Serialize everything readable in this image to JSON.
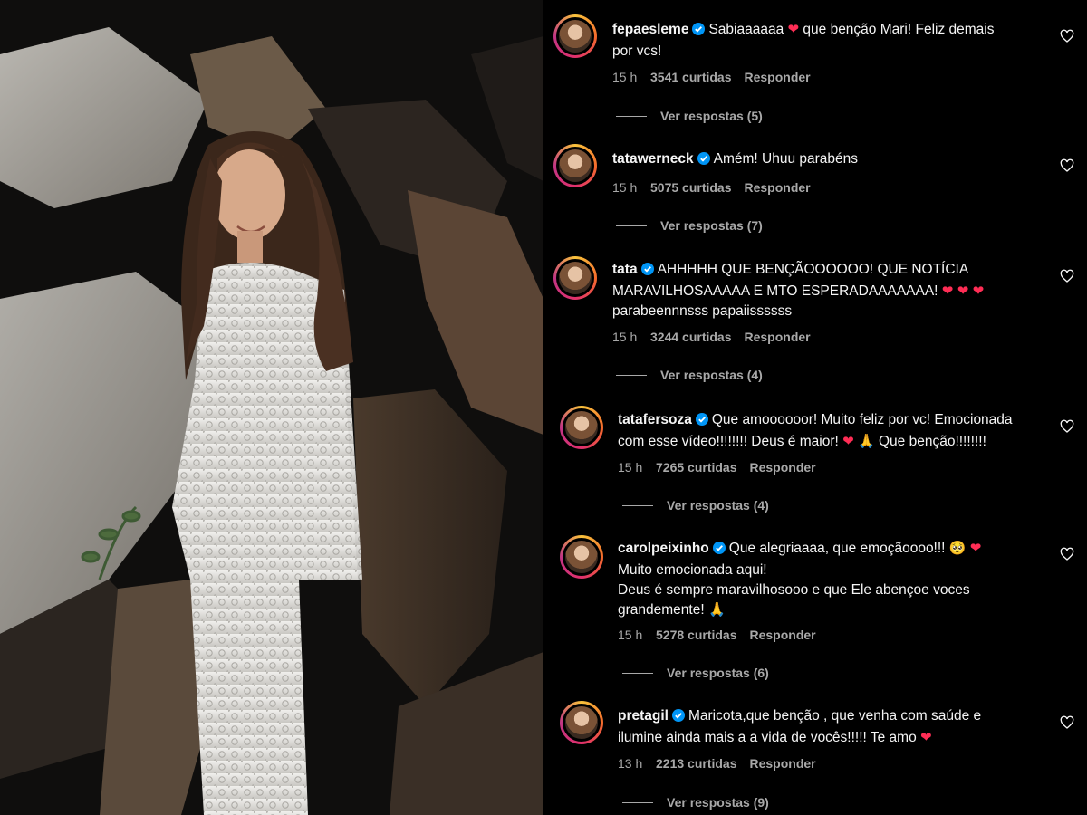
{
  "colors": {
    "background": "#000000",
    "text": "#f5f5f5",
    "secondary_text": "#a8a8a8",
    "verified": "#0095f6",
    "heart": "#ff2d55"
  },
  "comments": [
    {
      "username": "fepaesleme",
      "verified": true,
      "text_lines": [
        "Sabiaaaaaa {heart} que benção Mari! Feliz demais",
        "por vcs!"
      ],
      "time": "15 h",
      "likes": "3541 curtidas",
      "reply_label": "Responder",
      "view_replies": "Ver respostas (5)"
    },
    {
      "username": "tatawerneck",
      "verified": true,
      "text_lines": [
        "Amém! Uhuu parabéns"
      ],
      "time": "15 h",
      "likes": "5075 curtidas",
      "reply_label": "Responder",
      "view_replies": "Ver respostas (7)"
    },
    {
      "username": "tata",
      "verified": true,
      "text_lines": [
        "AHHHHH QUE BENÇÃOOOOOO! QUE NOTÍCIA",
        "MARAVILHOSAAAAA E MTO ESPERADAAAAAAA! {heart} {heart} {heart}",
        "parabeennnsss papaiissssss"
      ],
      "time": "15 h",
      "likes": "3244 curtidas",
      "reply_label": "Responder",
      "view_replies": "Ver respostas (4)"
    },
    {
      "username": "tatafersoza",
      "verified": true,
      "text_lines": [
        "Que amoooooor! Muito feliz por vc! Emocionada",
        "com esse vídeo!!!!!!!! Deus é maior! {heart} {pray} Que benção!!!!!!!!"
      ],
      "time": "15 h",
      "likes": "7265 curtidas",
      "reply_label": "Responder",
      "view_replies": "Ver respostas (4)"
    },
    {
      "username": "carolpeixinho",
      "verified": true,
      "text_lines": [
        "Que alegriaaaa, que emoçãoooo!!! {cry} {heart}",
        "Muito emocionada aqui!",
        "Deus é sempre maravilhosooo e que Ele abençoe voces",
        "grandemente! {pray}"
      ],
      "time": "15 h",
      "likes": "5278 curtidas",
      "reply_label": "Responder",
      "view_replies": "Ver respostas (6)"
    },
    {
      "username": "pretagil",
      "verified": true,
      "text_lines": [
        "Maricota,que benção , que venha com saúde e",
        "ilumine ainda mais a a vida de vocês!!!!! Te amo {heart}"
      ],
      "time": "13 h",
      "likes": "2213 curtidas",
      "reply_label": "Responder",
      "view_replies": "Ver respostas (9)"
    }
  ],
  "icons": {
    "verified": "verified-badge-icon",
    "like": "heart-outline-icon",
    "heart_emoji": "red-heart-emoji",
    "pray_emoji": "praying-hands-emoji",
    "cry_emoji": "crying-face-emoji"
  }
}
